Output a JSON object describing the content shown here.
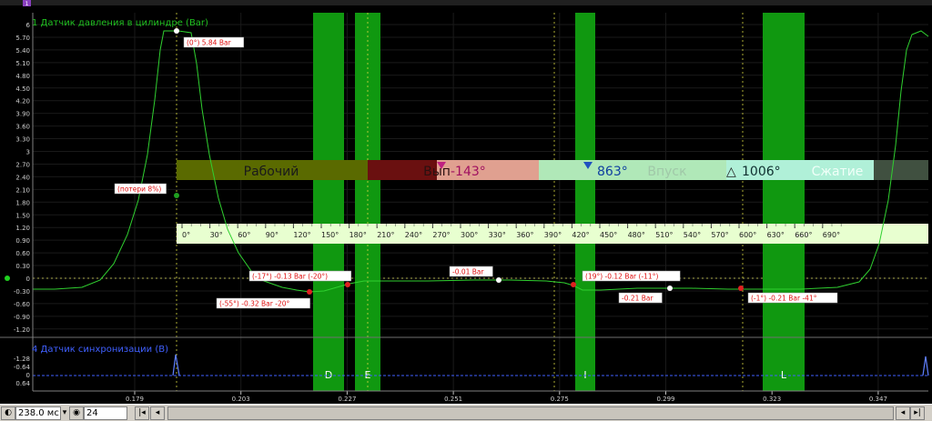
{
  "channel1": {
    "title": "1 Датчик давления в цилиндре (Bar)",
    "color": "#20c020",
    "y_ticks": [
      "6",
      "5.70",
      "5.40",
      "5.10",
      "4.80",
      "4.50",
      "4.20",
      "3.90",
      "3.60",
      "3.30",
      "3",
      "2.70",
      "2.40",
      "2.10",
      "1.80",
      "1.50",
      "1.20",
      "0.90",
      "0.60",
      "0.30",
      "0",
      "-0.30",
      "-0.60",
      "-0.90",
      "-1.20"
    ]
  },
  "channel4": {
    "title": "4 Датчик синхронизации (В)",
    "color": "#4060ff",
    "y_ticks": [
      "-1.28",
      "-0.64",
      "0",
      "0.64"
    ]
  },
  "time_axis": {
    "ticks": [
      "0.179",
      "0.203",
      "0.227",
      "0.251",
      "0.275",
      "0.299",
      "0.323",
      "0.347"
    ]
  },
  "phase_strip": {
    "labels": [
      "Рабочий",
      "Вып",
      "Впуск",
      "Сжатие"
    ],
    "marker_values": [
      "-143°",
      "863°",
      "1006°"
    ],
    "delta_symbol": "△"
  },
  "degree_scale": {
    "ticks": [
      "0°",
      "30°",
      "60°",
      "90°",
      "120°",
      "150°",
      "180°",
      "210°",
      "240°",
      "270°",
      "300°",
      "330°",
      "360°",
      "390°",
      "420°",
      "450°",
      "480°",
      "510°",
      "540°",
      "570°",
      "600°",
      "630°",
      "660°",
      "690°"
    ]
  },
  "cursor_letters": [
    "D",
    "E",
    "I",
    "L"
  ],
  "annotations": [
    {
      "text": "(0°) 5.84 Bar"
    },
    {
      "text": "(потери 8%)"
    },
    {
      "text": "(-17°) -0.13 Bar (-20°)"
    },
    {
      "text": "(-55°) -0.32 Bar -20°"
    },
    {
      "text": "-0.01 Bar"
    },
    {
      "text": "(19°) -0.12 Bar (-11°)"
    },
    {
      "text": "-0.21 Bar"
    },
    {
      "text": "(-1°) -0.21 Bar -41°"
    }
  ],
  "statusbar": {
    "time_value": "238.0 мс",
    "count_value": "24"
  },
  "top_marker": "1",
  "colors": {
    "cursor_band": "#109810",
    "trace": "#30d030",
    "annotation_text": "#e01010",
    "scale_bg": "#e8ffd0"
  }
}
